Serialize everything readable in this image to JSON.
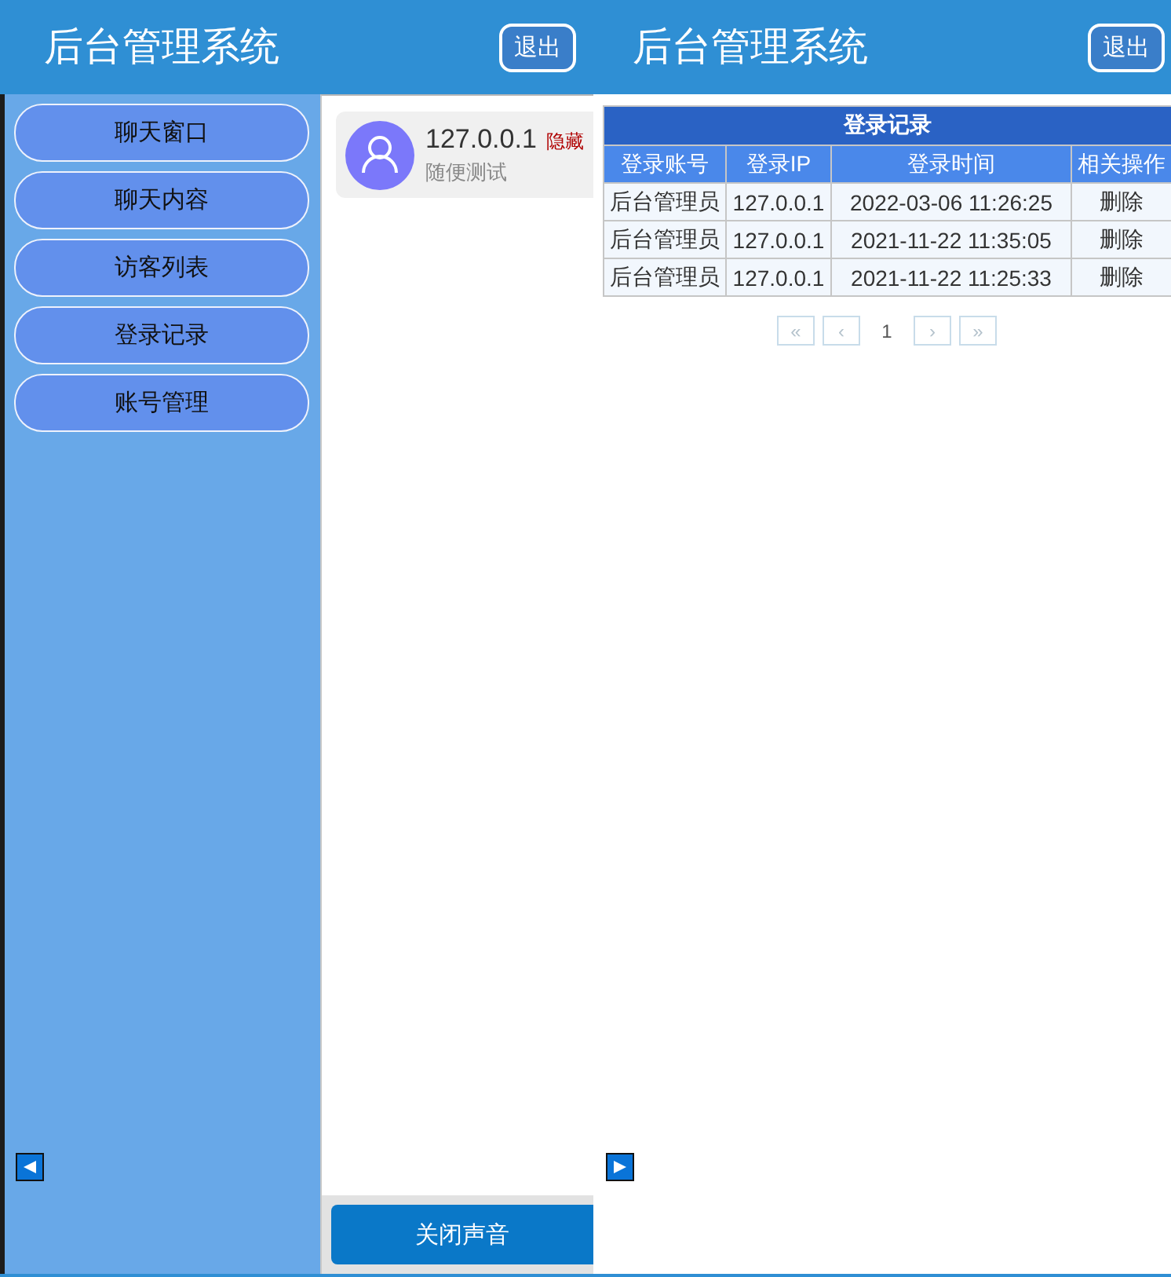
{
  "left_window": {
    "header": {
      "title": "后台管理系统",
      "logout_button": "退出"
    },
    "sidebar": {
      "items": [
        {
          "label": "聊天窗口",
          "selected": false
        },
        {
          "label": "聊天内容",
          "selected": false
        },
        {
          "label": "访客列表",
          "selected": false
        },
        {
          "label": "登录记录",
          "selected": false
        },
        {
          "label": "账号管理",
          "selected": false
        }
      ]
    },
    "chat_list": [
      {
        "ip": "127.0.0.1",
        "tag": "隐藏",
        "message": "随便测试"
      }
    ],
    "sound_button": "关闭声音"
  },
  "right_window": {
    "header": {
      "title": "后台管理系统",
      "logout_button": "退出"
    },
    "table": {
      "caption": "登录记录",
      "columns": [
        "登录账号",
        "登录IP",
        "登录时间",
        "相关操作"
      ],
      "rows": [
        {
          "cells": [
            "后台管理员",
            "127.0.0.1",
            "2022-03-06 11:26:25"
          ],
          "action": "删除"
        },
        {
          "cells": [
            "后台管理员",
            "127.0.0.1",
            "2021-11-22 11:35:05"
          ],
          "action": "删除"
        },
        {
          "cells": [
            "后台管理员",
            "127.0.0.1",
            "2021-11-22 11:25:33"
          ],
          "action": "删除"
        }
      ]
    },
    "pagination": [
      {
        "label": "«",
        "kind": "nav",
        "disabled": true
      },
      {
        "label": "‹",
        "kind": "nav",
        "disabled": true
      },
      {
        "label": "1",
        "kind": "current",
        "disabled": false
      },
      {
        "label": "›",
        "kind": "nav",
        "disabled": true
      },
      {
        "label": "»",
        "kind": "nav",
        "disabled": true
      }
    ]
  }
}
